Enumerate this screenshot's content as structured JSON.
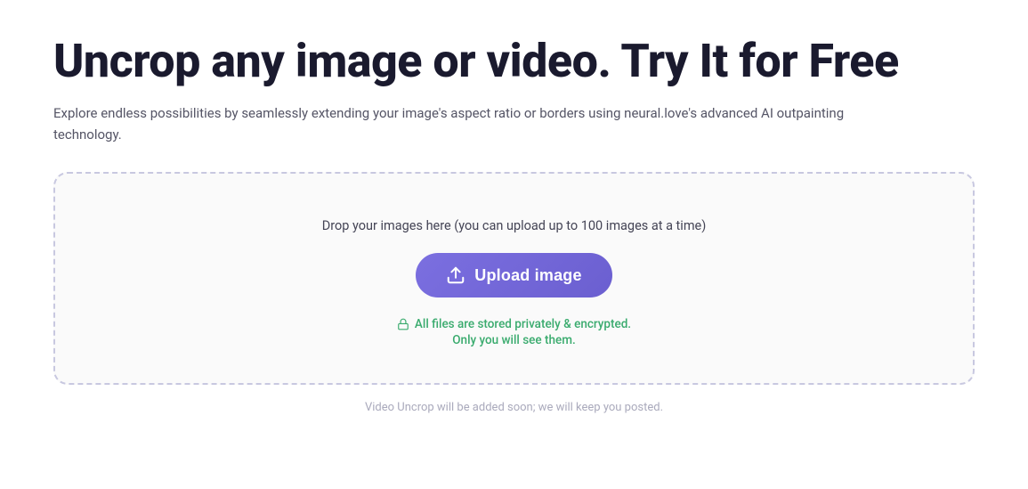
{
  "page": {
    "title": "Uncrop any image or video. Try It for Free",
    "description": "Explore endless possibilities by seamlessly extending your image's aspect ratio or borders using neural.love's advanced AI outpainting technology.",
    "upload_zone": {
      "drop_hint": "Drop your images here (you can upload up to 100 images at a time)",
      "upload_button_label": "Upload image",
      "privacy_line_1": "All files are stored privately & encrypted.",
      "privacy_line_2": "Only you will see them."
    },
    "footer_note": "Video Uncrop will be added soon; we will keep you posted.",
    "colors": {
      "accent": "#7b6fe0",
      "green": "#3aab6e"
    }
  }
}
